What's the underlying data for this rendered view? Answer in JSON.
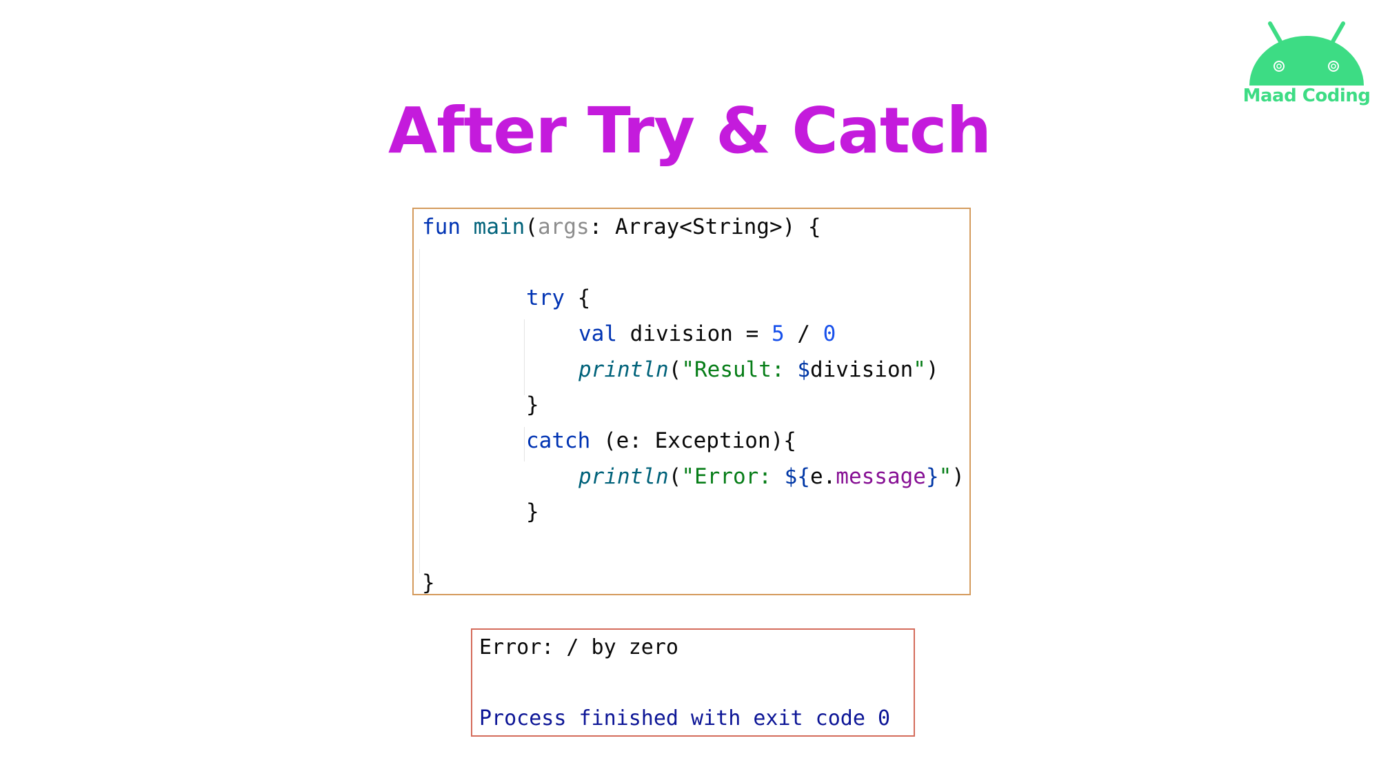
{
  "title": "After Try & Catch",
  "logo": {
    "text": "Maad Coding",
    "icon": "android-head-icon",
    "color": "#3ddc84"
  },
  "colors": {
    "title": "#c41bdc",
    "keyword": "#0033b3",
    "string": "#067d17",
    "number": "#1750eb",
    "property": "#871094",
    "process_text": "#0c1596",
    "code_border": "#d49a5c",
    "output_border": "#d46b5a"
  },
  "code": {
    "l1": {
      "kw": "fun",
      "fn": "main",
      "p1": "(",
      "param": "args",
      "rest": ": Array<String>) {"
    },
    "l3": {
      "kw": "try",
      "rest": " {"
    },
    "l4": {
      "kw": "val",
      "mid": " division = ",
      "n1": "5",
      "op": " / ",
      "n2": "0"
    },
    "l5": {
      "call": "println",
      "p1": "(",
      "str1": "\"Result: ",
      "tpl": "$",
      "var": "division",
      "str2": "\"",
      "p2": ")"
    },
    "l6": {
      "text": "}"
    },
    "l7": {
      "kw": "catch",
      "rest": " (e: Exception){"
    },
    "l8": {
      "call": "println",
      "p1": "(",
      "str1": "\"Error: ",
      "tpl1": "${",
      "var": "e.",
      "prop": "message",
      "tpl2": "}",
      "str2": "\"",
      "p2": ")"
    },
    "l9": {
      "text": "}"
    },
    "l11": {
      "text": "}"
    }
  },
  "output": {
    "error_line": "Error: / by zero",
    "process_line": "Process finished with exit code 0"
  }
}
